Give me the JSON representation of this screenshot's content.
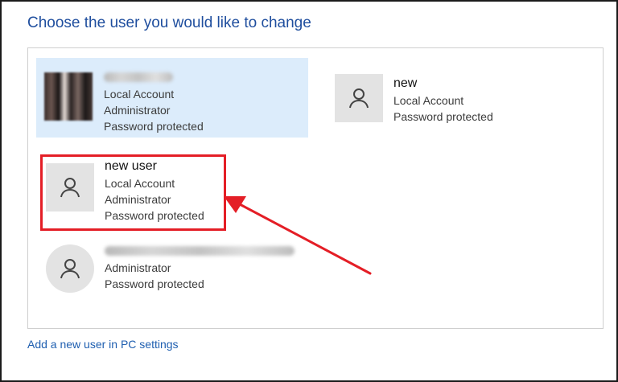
{
  "heading": "Choose the user you would like to change",
  "users": [
    {
      "name": "",
      "lines": [
        "Local Account",
        "Administrator",
        "Password protected"
      ],
      "avatar": "photo-avatar",
      "selected": true
    },
    {
      "name": "new",
      "lines": [
        "Local Account",
        "Password protected"
      ],
      "avatar": "person-icon",
      "selected": false
    },
    {
      "name": "new user",
      "lines": [
        "Local Account",
        "Administrator",
        "Password protected"
      ],
      "avatar": "person-icon",
      "selected": false,
      "highlighted": true
    },
    {
      "name": "",
      "lines": [
        "Administrator",
        "Password protected"
      ],
      "avatar": "person-icon",
      "selected": false
    }
  ],
  "add_user_link": "Add a new user in PC settings",
  "colors": {
    "heading": "#1f4e9e",
    "selected_bg": "#dcecfb",
    "annotation": "#e41e26",
    "link": "#1f5fb0"
  }
}
